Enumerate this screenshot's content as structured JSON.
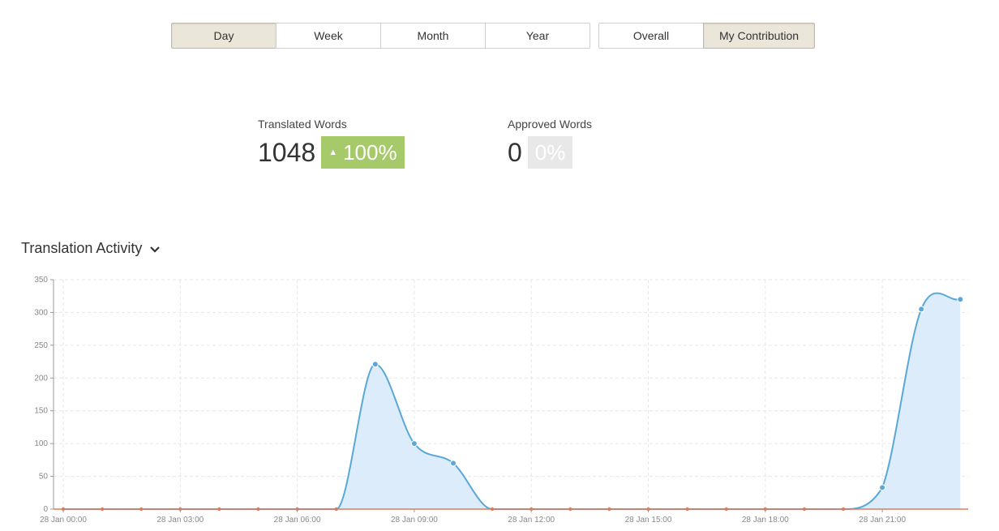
{
  "period_buttons": [
    {
      "label": "Day",
      "active": true
    },
    {
      "label": "Week",
      "active": false
    },
    {
      "label": "Month",
      "active": false
    },
    {
      "label": "Year",
      "active": false
    }
  ],
  "scope_buttons": [
    {
      "label": "Overall",
      "active": false
    },
    {
      "label": "My Contribution",
      "active": true
    }
  ],
  "stats": {
    "translated": {
      "label": "Translated Words",
      "value": "1048",
      "change": "100%"
    },
    "approved": {
      "label": "Approved Words",
      "value": "0",
      "change": "0%"
    }
  },
  "chart_section": {
    "title": "Translation Activity"
  },
  "colors": {
    "line": "#5aa8d8",
    "fill": "#ddecfa",
    "baseline": "#e07b5a",
    "badge_up": "#a6c96a",
    "badge_neutral": "#e8e8e8",
    "active_button": "#ebe6da"
  },
  "chart_data": {
    "type": "area",
    "title": "",
    "xlabel": "",
    "ylabel": "",
    "ylim": [
      0,
      350
    ],
    "yticks": [
      0,
      50,
      100,
      150,
      200,
      250,
      300,
      350
    ],
    "x_tick_labels": [
      "28 Jan 00:00",
      "28 Jan 03:00",
      "28 Jan 06:00",
      "28 Jan 09:00",
      "28 Jan 12:00",
      "28 Jan 15:00",
      "28 Jan 18:00",
      "28 Jan 21:00"
    ],
    "x_hours": [
      0,
      1,
      2,
      3,
      4,
      5,
      6,
      7,
      8,
      9,
      10,
      11,
      12,
      13,
      14,
      15,
      16,
      17,
      18,
      19,
      20,
      21,
      22,
      23
    ],
    "series": [
      {
        "values": [
          0,
          0,
          0,
          0,
          0,
          0,
          0,
          0,
          221,
          100,
          70,
          0,
          0,
          0,
          0,
          0,
          0,
          0,
          0,
          0,
          0,
          33,
          305,
          320
        ]
      }
    ],
    "grid": true
  }
}
